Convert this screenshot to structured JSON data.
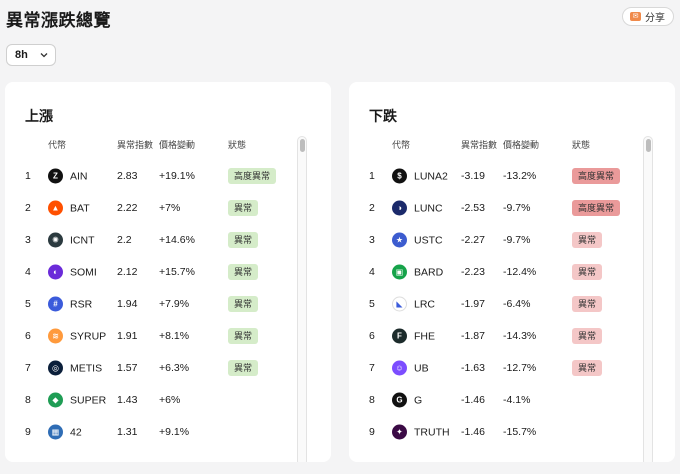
{
  "page": {
    "title": "異常漲跌總覽"
  },
  "share": {
    "label": "分享",
    "icon": "share-icon"
  },
  "period": {
    "selected": "8h",
    "icon": "chevron-down-icon"
  },
  "columns": {
    "coin": "代幣",
    "score": "異常指數",
    "change": "價格變動",
    "status": "狀態"
  },
  "gainers": {
    "title": "上漲",
    "rows": [
      {
        "rank": "1",
        "symbol": "AIN",
        "score": "2.83",
        "change": "+19.1%",
        "status": "高度異常",
        "level": "high",
        "icon_color": "#111111",
        "icon": "Z"
      },
      {
        "rank": "2",
        "symbol": "BAT",
        "score": "2.22",
        "change": "+7%",
        "status": "異常",
        "level": "normal",
        "icon_color": "#ff5000",
        "icon": "▲"
      },
      {
        "rank": "3",
        "symbol": "ICNT",
        "score": "2.2",
        "change": "+14.6%",
        "status": "異常",
        "level": "normal",
        "icon_color": "#2b3a3f",
        "icon": "✺"
      },
      {
        "rank": "4",
        "symbol": "SOMI",
        "score": "2.12",
        "change": "+15.7%",
        "status": "異常",
        "level": "normal",
        "icon_color": "#6b2bd9",
        "icon": "◐"
      },
      {
        "rank": "5",
        "symbol": "RSR",
        "score": "1.94",
        "change": "+7.9%",
        "status": "異常",
        "level": "normal",
        "icon_color": "#3b5bdb",
        "icon": "#"
      },
      {
        "rank": "6",
        "symbol": "SYRUP",
        "score": "1.91",
        "change": "+8.1%",
        "status": "異常",
        "level": "normal",
        "icon_color": "#ff9a3c",
        "icon": "≋"
      },
      {
        "rank": "7",
        "symbol": "METIS",
        "score": "1.57",
        "change": "+6.3%",
        "status": "異常",
        "level": "normal",
        "icon_color": "#0b1f3a",
        "icon": "◎"
      },
      {
        "rank": "8",
        "symbol": "SUPER",
        "score": "1.43",
        "change": "+6%",
        "status": "",
        "level": "none",
        "icon_color": "#1f9d55",
        "icon": "◆"
      },
      {
        "rank": "9",
        "symbol": "42",
        "score": "1.31",
        "change": "+9.1%",
        "status": "",
        "level": "none",
        "icon_color": "#2f6db5",
        "icon": "▦"
      }
    ]
  },
  "losers": {
    "title": "下跌",
    "rows": [
      {
        "rank": "1",
        "symbol": "LUNA2",
        "score": "-3.19",
        "change": "-13.2%",
        "status": "高度異常",
        "level": "high",
        "icon_color": "#111111",
        "icon": "$"
      },
      {
        "rank": "2",
        "symbol": "LUNC",
        "score": "-2.53",
        "change": "-9.7%",
        "status": "高度異常",
        "level": "high",
        "icon_color": "#1b2a6b",
        "icon": "◑"
      },
      {
        "rank": "3",
        "symbol": "USTC",
        "score": "-2.27",
        "change": "-9.7%",
        "status": "異常",
        "level": "normal",
        "icon_color": "#3c5ccf",
        "icon": "★"
      },
      {
        "rank": "4",
        "symbol": "BARD",
        "score": "-2.23",
        "change": "-12.4%",
        "status": "異常",
        "level": "normal",
        "icon_color": "#16a34a",
        "icon": "▣"
      },
      {
        "rank": "5",
        "symbol": "LRC",
        "score": "-1.97",
        "change": "-6.4%",
        "status": "異常",
        "level": "normal",
        "icon_color": "#ffffff",
        "icon": "◣"
      },
      {
        "rank": "6",
        "symbol": "FHE",
        "score": "-1.87",
        "change": "-14.3%",
        "status": "異常",
        "level": "normal",
        "icon_color": "#1c2b2b",
        "icon": "F"
      },
      {
        "rank": "7",
        "symbol": "UB",
        "score": "-1.63",
        "change": "-12.7%",
        "status": "異常",
        "level": "normal",
        "icon_color": "#7c4dff",
        "icon": "☺"
      },
      {
        "rank": "8",
        "symbol": "G",
        "score": "-1.46",
        "change": "-4.1%",
        "status": "",
        "level": "none",
        "icon_color": "#111111",
        "icon": "G"
      },
      {
        "rank": "9",
        "symbol": "TRUTH",
        "score": "-1.46",
        "change": "-15.7%",
        "status": "",
        "level": "none",
        "icon_color": "#3b0a45",
        "icon": "✦"
      }
    ]
  }
}
